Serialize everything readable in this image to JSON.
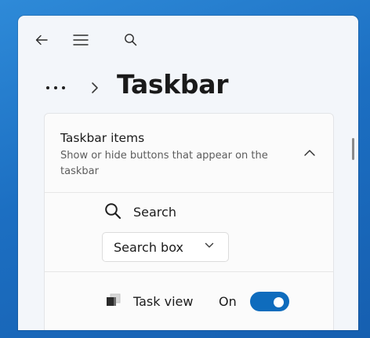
{
  "window": {
    "nav": {
      "back_icon": "arrow-left-icon",
      "menu_icon": "hamburger-icon",
      "search_icon": "search-icon"
    },
    "breadcrumb": {
      "overflow_icon": "more-horizontal-icon",
      "separator_icon": "chevron-right-icon",
      "page_title": "Taskbar"
    }
  },
  "taskbar_items": {
    "title": "Taskbar items",
    "description": "Show or hide buttons that appear on the taskbar",
    "expanded": true,
    "collapse_icon": "chevron-up-icon",
    "search": {
      "icon": "search-icon",
      "label": "Search",
      "dropdown_value": "Search box",
      "dropdown_icon": "chevron-down-icon"
    },
    "task_view": {
      "icon": "task-view-icon",
      "label": "Task view",
      "state_label": "On",
      "enabled": true
    }
  },
  "colors": {
    "accent": "#0f6cbd",
    "window_bg": "#f3f6fa",
    "card_bg": "#fbfbfb",
    "text_primary": "#1b1b1b",
    "text_secondary": "#5d5d5d"
  }
}
